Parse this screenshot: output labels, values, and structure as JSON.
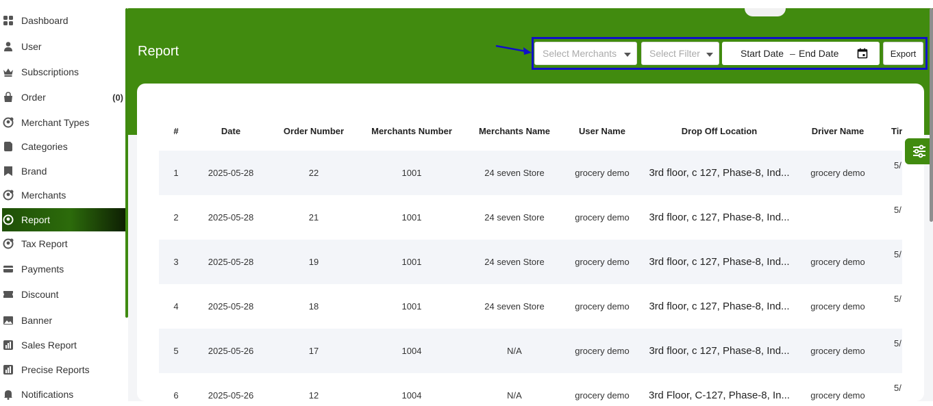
{
  "sidebar": {
    "items": [
      {
        "label": "Dashboard",
        "icon": "grid-icon"
      },
      {
        "label": "User",
        "icon": "user-icon"
      },
      {
        "label": "Subscriptions",
        "icon": "crown-icon"
      },
      {
        "label": "Order",
        "icon": "bag-icon",
        "count": "(0)"
      },
      {
        "label": "Merchant Types",
        "icon": "merchant-type-icon"
      },
      {
        "label": "Categories",
        "icon": "categories-icon"
      },
      {
        "label": "Brand",
        "icon": "brand-icon"
      },
      {
        "label": "Merchants",
        "icon": "merchant-icon"
      },
      {
        "label": "Report",
        "icon": "report-icon",
        "active": true
      },
      {
        "label": "Tax Report",
        "icon": "tax-report-icon"
      },
      {
        "label": "Payments",
        "icon": "payments-icon"
      },
      {
        "label": "Discount",
        "icon": "discount-icon"
      },
      {
        "label": "Banner",
        "icon": "banner-icon"
      },
      {
        "label": "Sales Report",
        "icon": "sales-report-icon"
      },
      {
        "label": "Precise Reports",
        "icon": "precise-report-icon"
      },
      {
        "label": "Notifications",
        "icon": "bell-icon"
      }
    ]
  },
  "header": {
    "title": "Report",
    "merchant_select_placeholder": "Select Merchants",
    "filter_select_placeholder": "Select Filter",
    "start_date": "Start Date",
    "date_separator": "–",
    "end_date": "End Date",
    "export_label": "Export"
  },
  "table": {
    "columns": [
      "#",
      "Date",
      "Order Number",
      "Merchants Number",
      "Merchants Name",
      "User Name",
      "Drop Off Location",
      "Driver Name",
      "Tir"
    ],
    "rows": [
      [
        "1",
        "2025-05-28",
        "22",
        "1001",
        "24 seven Store",
        "grocery demo",
        "3rd floor, c 127, Phase-8, Ind...",
        "grocery demo",
        "5/"
      ],
      [
        "2",
        "2025-05-28",
        "21",
        "1001",
        "24 seven Store",
        "grocery demo",
        "3rd floor, c 127, Phase-8, Ind...",
        "",
        "5/"
      ],
      [
        "3",
        "2025-05-28",
        "19",
        "1001",
        "24 seven Store",
        "grocery demo",
        "3rd floor, c 127, Phase-8, Ind...",
        "grocery demo",
        "5/"
      ],
      [
        "4",
        "2025-05-28",
        "18",
        "1001",
        "24 seven Store",
        "grocery demo",
        "3rd floor, c 127, Phase-8, Ind...",
        "grocery demo",
        "5/"
      ],
      [
        "5",
        "2025-05-26",
        "17",
        "1004",
        "N/A",
        "grocery demo",
        "3rd floor, c 127, Phase-8, Ind...",
        "grocery demo",
        "5/"
      ],
      [
        "6",
        "2025-05-26",
        "12",
        "1004",
        "N/A",
        "grocery demo",
        "3rd Floor, C-127, Phase-8, In...",
        "grocery demo",
        "5/:"
      ]
    ]
  },
  "colors": {
    "brand_green": "#418b0f",
    "highlight_border": "#1010c8"
  }
}
